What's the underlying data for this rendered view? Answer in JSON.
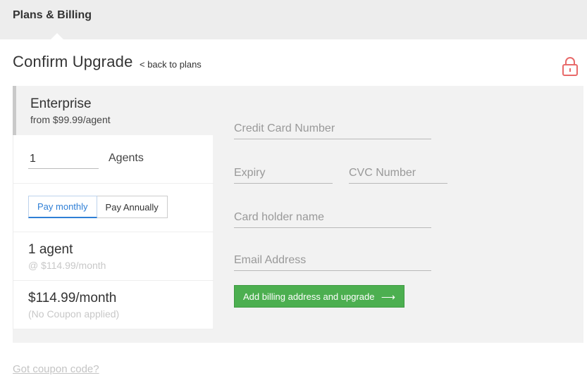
{
  "header": {
    "title": "Plans & Billing"
  },
  "page": {
    "title": "Confirm Upgrade",
    "back_link": "< back to plans"
  },
  "plan": {
    "name": "Enterprise",
    "price": "from $99.99/agent"
  },
  "agents": {
    "value": "1",
    "label": "Agents"
  },
  "billing_toggle": {
    "monthly": "Pay monthly",
    "annually": "Pay Annually",
    "selected": "Pay monthly"
  },
  "summary": {
    "agent_count": "1 agent",
    "agent_rate": "@ $114.99/month",
    "total": "$114.99/month",
    "coupon_status": "(No Coupon applied)"
  },
  "form": {
    "card_number_placeholder": "Credit Card Number",
    "expiry_placeholder": "Expiry",
    "cvc_placeholder": "CVC Number",
    "holder_placeholder": "Card holder name",
    "email_placeholder": "Email Address"
  },
  "submit": {
    "label": "Add billing address and upgrade",
    "arrow": "⟶"
  },
  "coupon_link": "Got coupon code?",
  "colors": {
    "accent_blue": "#2f7fd6",
    "submit_green": "#4caf50",
    "lock_red": "#e86a6a",
    "topbar_bg": "#ededed",
    "panel_bg": "#f2f2f2"
  }
}
